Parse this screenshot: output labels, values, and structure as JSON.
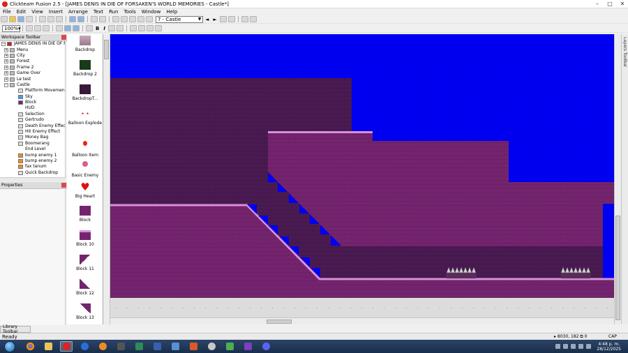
{
  "window": {
    "title": "Clickteam Fusion 2.5 - [JAMES DENIS IN DIE OF FORSAKEN'S WORLD MEMORIES - Castle*]",
    "minimize": "–",
    "maximize": "□",
    "close": "✕"
  },
  "menu": [
    "File",
    "Edit",
    "View",
    "Insert",
    "Arrange",
    "Text",
    "Run",
    "Tools",
    "Window",
    "Help"
  ],
  "toolbar": {
    "frame_select": "7 - Castle",
    "prev_frame": "◄",
    "next_frame": "►",
    "zoom": "100%",
    "bold_label": "B",
    "italic_label": "I"
  },
  "workspace": {
    "header": "Workspace Toolbar",
    "tree": [
      {
        "label": "JAMES DENIS IN DIE OF FO",
        "depth": 0,
        "expand": "−",
        "icon": "app"
      },
      {
        "label": "Menu",
        "depth": 1,
        "expand": "+",
        "icon": "frame"
      },
      {
        "label": "City",
        "depth": 1,
        "expand": "+",
        "icon": "frame"
      },
      {
        "label": "Forest",
        "depth": 1,
        "expand": "+",
        "icon": "frame"
      },
      {
        "label": "Frame 2",
        "depth": 1,
        "expand": "+",
        "icon": "frame"
      },
      {
        "label": "Game Over",
        "depth": 1,
        "expand": "+",
        "icon": "frame"
      },
      {
        "label": "Le test",
        "depth": 1,
        "expand": "+",
        "icon": "frame"
      },
      {
        "label": "Castle",
        "depth": 1,
        "expand": "−",
        "icon": "frame"
      },
      {
        "label": "Platform Movemen",
        "depth": 2,
        "expand": "",
        "icon": "obj"
      },
      {
        "label": "Sky",
        "depth": 2,
        "expand": "",
        "icon": "sky"
      },
      {
        "label": "Block",
        "depth": 2,
        "expand": "",
        "icon": "block"
      },
      {
        "label": "HUD",
        "depth": 2,
        "expand": "",
        "icon": "none"
      },
      {
        "label": "Selection",
        "depth": 2,
        "expand": "",
        "icon": "obj"
      },
      {
        "label": "Gertrudo",
        "depth": 2,
        "expand": "",
        "icon": "obj"
      },
      {
        "label": "Death Enemy Effect",
        "depth": 2,
        "expand": "",
        "icon": "obj"
      },
      {
        "label": "Hit Enemy Effect",
        "depth": 2,
        "expand": "",
        "icon": "obj"
      },
      {
        "label": "Money Bag",
        "depth": 2,
        "expand": "",
        "icon": "obj"
      },
      {
        "label": "Boomerang",
        "depth": 2,
        "expand": "",
        "icon": "obj"
      },
      {
        "label": "End Level",
        "depth": 2,
        "expand": "",
        "icon": "none"
      },
      {
        "label": "bump enemy 1",
        "depth": 2,
        "expand": "",
        "icon": "orange"
      },
      {
        "label": "bump enemy 2",
        "depth": 2,
        "expand": "",
        "icon": "orange"
      },
      {
        "label": "fax tanum",
        "depth": 2,
        "expand": "",
        "icon": "orange"
      },
      {
        "label": "Quick Backdrop",
        "depth": 2,
        "expand": "",
        "icon": "obj"
      }
    ]
  },
  "properties": {
    "header": "Properties"
  },
  "library": {
    "header": "Library Toolbar"
  },
  "objects": [
    {
      "label": "Backdrop",
      "icon": "backdrop"
    },
    {
      "label": "Backdrop 2",
      "icon": "backdrop2"
    },
    {
      "label": "BackdropT...",
      "icon": "backdropt"
    },
    {
      "label": "Balloon Explode",
      "icon": "balloon-explode"
    },
    {
      "label": "Balloon Item",
      "icon": "balloon-item"
    },
    {
      "label": "Basic Enemy",
      "icon": "basic-enemy"
    },
    {
      "label": "Big Heart",
      "icon": "big-heart"
    },
    {
      "label": "Block",
      "icon": "block"
    },
    {
      "label": "Block 10",
      "icon": "block10"
    },
    {
      "label": "Block 11",
      "icon": "block11"
    },
    {
      "label": "Block 12",
      "icon": "block12"
    },
    {
      "label": "Block 13",
      "icon": "block13"
    }
  ],
  "colors": {
    "sky": "#0000f0",
    "dark_wall": "#4a1a52",
    "purple_block": "#74246e",
    "ledge": "#d890d8",
    "floor": "#dcdcdc",
    "outside": "#e0e0e0"
  },
  "status": {
    "text": "Ready",
    "coords": "8030, 182",
    "count": "0",
    "caps": "CAP"
  },
  "taskbar": {
    "time": "4:48 p. m.",
    "date": "28/12/2025"
  }
}
